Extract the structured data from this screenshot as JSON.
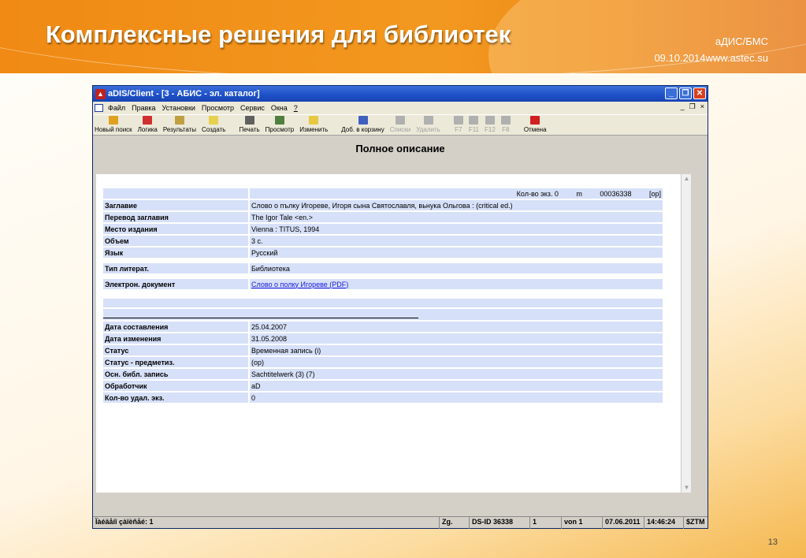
{
  "slide": {
    "title": "Комплексные решения для библиотек",
    "meta_line1": "аДИС/БМС",
    "meta_line2": "09.10.2014www.astec.su",
    "page_number": "13"
  },
  "window": {
    "title": "aDIS/Client - [3 - АБИС - эл. каталог]",
    "menu": [
      "Файл",
      "Правка",
      "Установки",
      "Просмотр",
      "Сервис",
      "Окна",
      "?"
    ],
    "toolbar": [
      {
        "label": "Новый поиск",
        "icon": "new-search-icon",
        "color": "#e0a020",
        "enabled": true
      },
      {
        "label": "Логика",
        "icon": "logic-icon",
        "color": "#d03030",
        "enabled": true
      },
      {
        "label": "Результаты",
        "icon": "results-icon",
        "color": "#c0a040",
        "enabled": true
      },
      {
        "label": "Создать",
        "icon": "create-icon",
        "color": "#e8d050",
        "enabled": true
      },
      {
        "label": "Печать",
        "icon": "print-icon",
        "color": "#606060",
        "enabled": true
      },
      {
        "label": "Просмотр",
        "icon": "preview-icon",
        "color": "#508040",
        "enabled": true
      },
      {
        "label": "Изменить",
        "icon": "edit-icon",
        "color": "#e8c840",
        "enabled": true
      },
      {
        "label": "Доб. в корзину",
        "icon": "basket-icon",
        "color": "#4060c0",
        "enabled": true
      },
      {
        "label": "Списки",
        "icon": "lists-icon",
        "color": "#b0b0b0",
        "enabled": false
      },
      {
        "label": "Удалить",
        "icon": "delete-icon",
        "color": "#b0b0b0",
        "enabled": false
      },
      {
        "label": "F7",
        "icon": "f7-icon",
        "color": "#b0b0b0",
        "enabled": false
      },
      {
        "label": "F11",
        "icon": "f11-icon",
        "color": "#b0b0b0",
        "enabled": false
      },
      {
        "label": "F12",
        "icon": "f12-icon",
        "color": "#b0b0b0",
        "enabled": false
      },
      {
        "label": "F8",
        "icon": "f8-icon",
        "color": "#b0b0b0",
        "enabled": false
      },
      {
        "label": "Отмена",
        "icon": "cancel-icon",
        "color": "#d02020",
        "enabled": true
      }
    ],
    "heading": "Полное описание",
    "record_header": {
      "copies": "Кол-во экз. 0",
      "m": "m",
      "id": "00036338",
      "status": "[op]"
    },
    "fields_group1": [
      {
        "label": "Заглавие",
        "value": "Слово о пълку Игореве, Игоря сына Святославля, вьнука Ольгова : (critical ed.)"
      },
      {
        "label": "Перевод заглавия",
        "value": "The Igor Tale <en.>"
      },
      {
        "label": "Место издания",
        "value": "Vienna : TITUS, 1994"
      },
      {
        "label": "Объем",
        "value": "3 с."
      },
      {
        "label": "Язык",
        "value": "Русский"
      }
    ],
    "fields_group2": [
      {
        "label": "Тип литерат.",
        "value": "Библиотека"
      }
    ],
    "e_doc": {
      "label": "Электрон. документ",
      "value": "Слово о полку Игореве (PDF)"
    },
    "fields_group3": [
      {
        "label": "Дата составления",
        "value": "25.04.2007"
      },
      {
        "label": "Дата изменения",
        "value": "31.05.2008"
      },
      {
        "label": "Статус",
        "value": "Временная запись  (i)"
      },
      {
        "label": "Статус - предметиз.",
        "value": "(op)"
      },
      {
        "label": "Осн. библ. запись",
        "value": "Sachtitelwerk  (3)  (7)"
      },
      {
        "label": "Обработчик",
        "value": "aD"
      },
      {
        "label": "Кол-во удал. экз.",
        "value": "0"
      }
    ],
    "statusbar": [
      "Ïàéäåíî çàïèñåé: 1",
      "Zg.",
      "DS-ID 36338",
      "1",
      "von 1",
      "07.06.2011",
      "14:46:24",
      "$ZTM"
    ]
  }
}
